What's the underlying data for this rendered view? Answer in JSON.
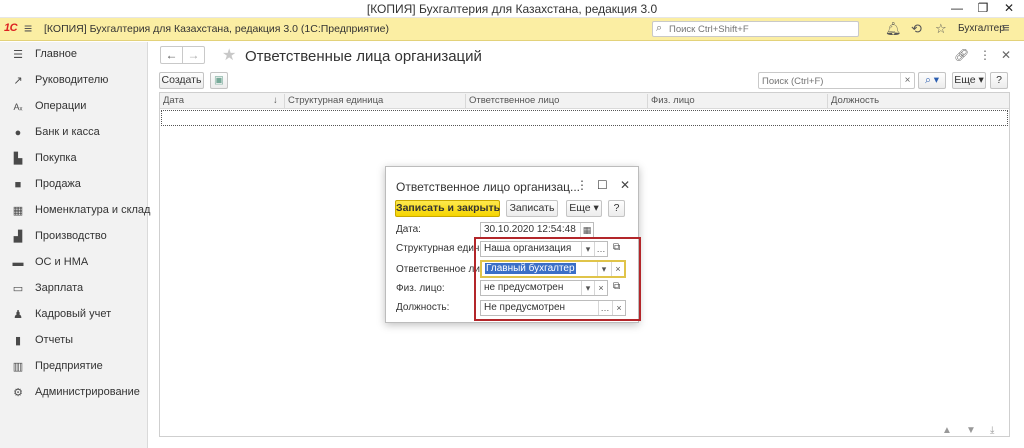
{
  "window": {
    "title": "[КОПИЯ] Бухгалтерия для Казахстана, редакция 3.0",
    "minimize": "—",
    "maximize": "❐",
    "close": "✕"
  },
  "appbar": {
    "logo": "1С",
    "title": "[КОПИЯ] Бухгалтерия для Казахстана, редакция 3.0  (1С:Предприятие)",
    "search_placeholder": "Поиск Ctrl+Shift+F",
    "user": "Бухгалтер",
    "icons": [
      "bell-icon",
      "history-icon",
      "star-icon"
    ]
  },
  "sidebar": {
    "items": [
      {
        "label": "Главное",
        "icon": "menu-icon"
      },
      {
        "label": "Руководителю",
        "icon": "trend-icon"
      },
      {
        "label": "Операции",
        "icon": "operations-icon"
      },
      {
        "label": "Банк и касса",
        "icon": "bank-icon"
      },
      {
        "label": "Покупка",
        "icon": "cart-icon"
      },
      {
        "label": "Продажа",
        "icon": "bag-icon"
      },
      {
        "label": "Номенклатура и склад",
        "icon": "grid-icon"
      },
      {
        "label": "Производство",
        "icon": "factory-icon"
      },
      {
        "label": "ОС и НМА",
        "icon": "truck-icon"
      },
      {
        "label": "Зарплата",
        "icon": "salary-icon"
      },
      {
        "label": "Кадровый учет",
        "icon": "people-icon"
      },
      {
        "label": "Отчеты",
        "icon": "reports-icon"
      },
      {
        "label": "Предприятие",
        "icon": "building-icon"
      },
      {
        "label": "Администрирование",
        "icon": "gear-icon"
      }
    ]
  },
  "content": {
    "title": "Ответственные лица организаций",
    "toolbar": {
      "create_label": "Создать",
      "search_placeholder": "Поиск (Ctrl+F)",
      "more_label": "Еще",
      "help_label": "?"
    },
    "table": {
      "columns": [
        "Дата",
        "Структурная единица",
        "Ответственное лицо",
        "Физ. лицо",
        "Должность"
      ],
      "sort_indicator": "↓",
      "rows": []
    }
  },
  "dialog": {
    "title": "Ответственное лицо организац...",
    "buttons": {
      "save_close": "Записать и закрыть",
      "save": "Записать",
      "more": "Еще",
      "help": "?"
    },
    "fields": {
      "date": {
        "label": "Дата:",
        "value": "30.10.2020 12:54:48"
      },
      "struct_unit": {
        "label": "Структурная единица:",
        "value": "Наша организация"
      },
      "responsible": {
        "label": "Ответственное лицо:",
        "value": "Главный бухгалтер"
      },
      "person": {
        "label": "Физ. лицо:",
        "value": "не предусмотрен"
      },
      "position": {
        "label": "Должность:",
        "value": "Не предусмотрен"
      }
    }
  }
}
